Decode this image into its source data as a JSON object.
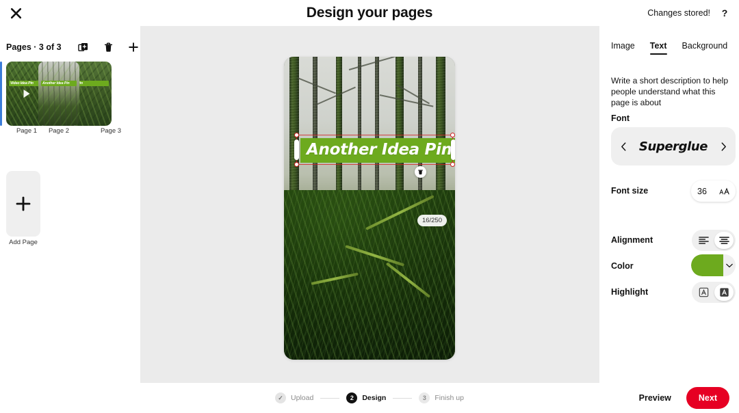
{
  "header": {
    "title": "Design your pages",
    "close_icon": "close-icon",
    "status": "Changes stored!",
    "help_icon": "help-icon",
    "help_label": "?"
  },
  "sidebar": {
    "pages_label": "Pages · 3 of 3",
    "tools": [
      {
        "name": "duplicate-page-button",
        "icon": "duplicate-icon"
      },
      {
        "name": "delete-page-button",
        "icon": "trash-icon"
      },
      {
        "name": "add-page-button",
        "icon": "plus-icon"
      }
    ],
    "thumbnails": [
      {
        "label": "Page 1",
        "overlay_text": "Video Idea Pin",
        "selected": false,
        "has_video": true
      },
      {
        "label": "Page 2",
        "overlay_text": "Another Idea Pin",
        "selected": true,
        "has_video": false
      },
      {
        "label": "Page 3",
        "overlay_text": "a Pin",
        "selected": false,
        "has_video": false
      }
    ],
    "add_page": {
      "label": "Add Page",
      "icon": "plus-icon"
    }
  },
  "canvas": {
    "pin_text": "Another Idea Pin",
    "char_count": "16/250",
    "highlight_color": "#6DAA1E",
    "text_color": "#ffffff",
    "delete_icon": "trash-icon",
    "selection_color": "#cc2222"
  },
  "panel": {
    "tabs": [
      {
        "label": "Image",
        "active": false
      },
      {
        "label": "Text",
        "active": true
      },
      {
        "label": "Background",
        "active": false
      }
    ],
    "description": "Write a short description to help people understand what this page is about",
    "font_section_label": "Font",
    "font_value": "Superglue",
    "font_prev_icon": "chevron-left-icon",
    "font_next_icon": "chevron-right-icon",
    "font_size_label": "Font size",
    "font_size_value": "36",
    "font_size_icon": "font-size-icon",
    "alignment_label": "Alignment",
    "alignment_options": [
      {
        "name": "align-left-button",
        "icon": "align-left-icon",
        "selected": false
      },
      {
        "name": "align-center-button",
        "icon": "align-center-icon",
        "selected": true
      }
    ],
    "color_label": "Color",
    "color_value": "#6DAA1E",
    "color_chevron_icon": "chevron-down-icon",
    "highlight_label": "Highlight",
    "highlight_options": [
      {
        "name": "highlight-outline-button",
        "icon": "letter-outline-icon",
        "selected": false
      },
      {
        "name": "highlight-filled-button",
        "icon": "letter-filled-icon",
        "selected": true
      }
    ]
  },
  "footer": {
    "steps": [
      {
        "marker": "✓",
        "label": "Upload",
        "state": "done"
      },
      {
        "marker": "2",
        "label": "Design",
        "state": "active"
      },
      {
        "marker": "3",
        "label": "Finish up",
        "state": "todo"
      }
    ],
    "preview_label": "Preview",
    "next_label": "Next",
    "next_color": "#e60023"
  }
}
